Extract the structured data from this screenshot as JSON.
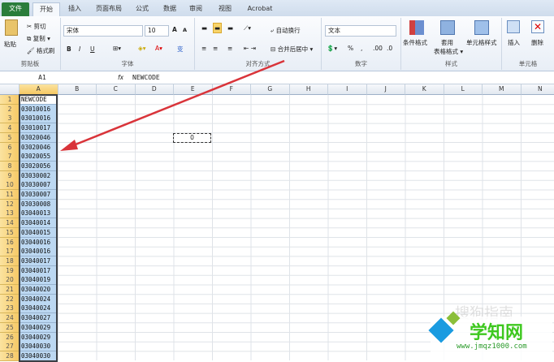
{
  "tabs": [
    "文件",
    "开始",
    "插入",
    "页面布局",
    "公式",
    "数据",
    "审阅",
    "视图",
    "Acrobat"
  ],
  "ribbon": {
    "clipboard": {
      "paste": "粘贴",
      "cut": "剪切",
      "copy": "复制 ▾",
      "format_painter": "格式刷",
      "label": "剪贴板"
    },
    "font": {
      "name": "宋体",
      "size": "10",
      "bold": "B",
      "italic": "I",
      "underline": "U",
      "grow": "A",
      "shrink": "A",
      "label": "字体",
      "wen": "变"
    },
    "alignment": {
      "wrap": "自动换行",
      "merge": "合并后居中 ▾",
      "label": "对齐方式"
    },
    "number": {
      "format": "文本",
      "percent": "%",
      "comma": ",",
      "inc": ".00",
      "dec": ".0",
      "label": "数字"
    },
    "styles": {
      "conditional": "条件格式",
      "table1": "套用",
      "table2": "表格格式 ▾",
      "cell": "单元格样式",
      "label": "样式"
    },
    "cells": {
      "insert": "插入",
      "delete": "删除",
      "label": "单元格"
    }
  },
  "formula_bar": {
    "name_box": "A1",
    "fx": "fx",
    "value": "NEWCODE"
  },
  "columns": [
    "A",
    "B",
    "C",
    "D",
    "E",
    "F",
    "G",
    "H",
    "I",
    "J",
    "K",
    "L",
    "M",
    "N"
  ],
  "rows": [
    "1",
    "2",
    "3",
    "4",
    "5",
    "6",
    "7",
    "8",
    "9",
    "10",
    "11",
    "12",
    "13",
    "14",
    "15",
    "16",
    "17",
    "18",
    "19",
    "20",
    "21",
    "22",
    "23",
    "24",
    "25",
    "26",
    "27",
    "28"
  ],
  "col_a": [
    "NEWCODE",
    "03010016",
    "03010016",
    "03010017",
    "03020046",
    "03020046",
    "03020055",
    "03020056",
    "03030002",
    "03030007",
    "03030007",
    "03030008",
    "03040013",
    "03040014",
    "03040015",
    "03040016",
    "03040016",
    "03040017",
    "03040017",
    "03040019",
    "03040020",
    "03040024",
    "03040024",
    "03040027",
    "03040029",
    "03040029",
    "03040030",
    "03040030"
  ],
  "e5": "0",
  "watermark": {
    "title": "学知网",
    "url": "www.jmqz1000.com",
    "faint": "搜狗指南"
  },
  "colors": {
    "selection": "#bcd8f2",
    "header_sel": "#f6c864",
    "arrow": "#d9343a",
    "file_tab": "#2a7d3b"
  }
}
